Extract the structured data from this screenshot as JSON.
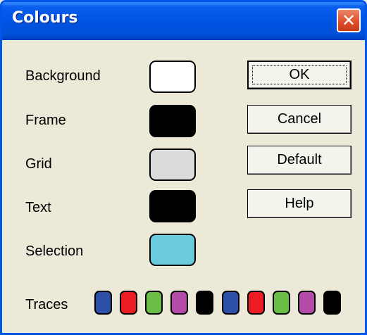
{
  "window": {
    "title": "Colours"
  },
  "colors": {
    "title_bar": "#0054E3",
    "close_button": "#E0512C",
    "dialog_bg": "#ECE9D8"
  },
  "rows": [
    {
      "label": "Background",
      "color": "#FFFFFF"
    },
    {
      "label": "Frame",
      "color": "#000000"
    },
    {
      "label": "Grid",
      "color": "#DCDCDC"
    },
    {
      "label": "Text",
      "color": "#000000"
    },
    {
      "label": "Selection",
      "color": "#6ACBDD"
    }
  ],
  "buttons": {
    "ok": "OK",
    "cancel": "Cancel",
    "default": "Default",
    "help": "Help"
  },
  "traces": {
    "label": "Traces",
    "colors": [
      "#2D4FA8",
      "#ED1C24",
      "#6BBE45",
      "#B44BA9",
      "#000000",
      "#2D4FA8",
      "#ED1C24",
      "#6BBE45",
      "#B44BA9",
      "#000000"
    ]
  }
}
